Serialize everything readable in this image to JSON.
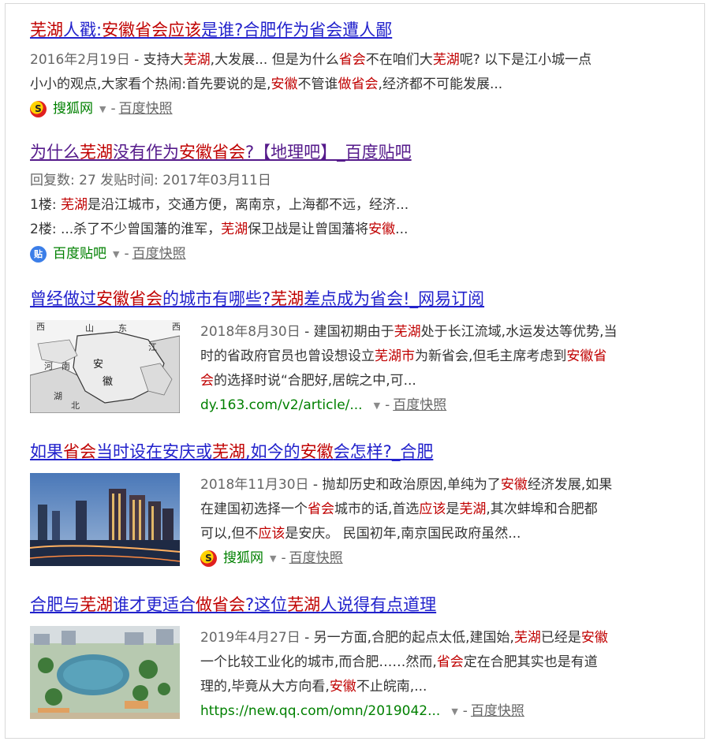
{
  "results": [
    {
      "title_parts": [
        "芜湖",
        "人戳:",
        "安徽省会",
        "应该",
        "是谁?合肥作为省会遭人鄙"
      ],
      "snippet_line1": [
        "2016年2月19日",
        " - 支持大",
        "芜湖",
        ",大发展... 但是为什么",
        "省会",
        "不在咱们大",
        "芜湖",
        "呢? 以下是江小城一点"
      ],
      "snippet_line2": [
        "小小的观点,大家看个热闹:首先要说的是,",
        "安徽",
        "不管谁",
        "做省会",
        ",经济都不可能发展..."
      ],
      "source": "搜狐网",
      "snapshot": "百度快照"
    },
    {
      "title_parts": [
        "为什么",
        "芜湖",
        "没有作为",
        "安徽省会",
        "?【地理吧】_百度贴吧"
      ],
      "meta": "回复数: 27 发贴时间: 2017年03月11日",
      "floor1": [
        "1楼: ",
        "芜湖",
        "是沿江城市，交通方便，离南京，上海都不远，经济..."
      ],
      "floor2": [
        "2楼: ...杀了不少曾国藩的淮军，",
        "芜湖",
        "保卫战是让曾国藩将",
        "安徽",
        "..."
      ],
      "source": "百度贴吧",
      "snapshot": "百度快照"
    },
    {
      "title_parts": [
        "曾经做过",
        "安徽省会",
        "的城市有哪些?",
        "芜湖",
        "差点成为省会!_网易订阅"
      ],
      "line1": [
        "2018年8月30日",
        " - 建国初期由于",
        "芜湖",
        "处于长江流域,水运发达等优势,当"
      ],
      "line2": [
        "时的省政府官员也曾设想设立",
        "芜湖市",
        "为新省会,但毛主席考虑到",
        "安徽省"
      ],
      "line3": [
        "会",
        "的选择时说“合肥好,居皖之中,可..."
      ],
      "url": "dy.163.com/v2/article/...",
      "snapshot": "百度快照",
      "map_labels": [
        "西",
        "山",
        "东",
        "河",
        "南",
        "安",
        "江",
        "徽",
        "湖",
        "北",
        "西"
      ]
    },
    {
      "title_parts": [
        "如果",
        "省会",
        "当时设在安庆或",
        "芜湖",
        ",如今的",
        "安徽",
        "会怎样?_合肥"
      ],
      "line1": [
        "2018年11月30日",
        " - 抛却历史和政治原因,单纯为了",
        "安徽",
        "经济发展,如果"
      ],
      "line2": [
        "在建国初选择一个",
        "省会",
        "城市的话,首选",
        "应该",
        "是",
        "芜湖",
        ",其次蚌埠和合肥都"
      ],
      "line3": [
        "可以,但不",
        "应该",
        "是安庆。 民国初年,南京国民政府虽然..."
      ],
      "source": "搜狐网",
      "snapshot": "百度快照"
    },
    {
      "title_parts": [
        "合肥与",
        "芜湖",
        "谁才更适合",
        "做省会",
        "?这位",
        "芜湖",
        "人说得有点道理"
      ],
      "line1": [
        "2019年4月27日",
        " - 另一方面,合肥的起点太低,建国始,",
        "芜湖",
        "已经是",
        "安徽"
      ],
      "line2": [
        "一个比较工业化的城市,而合肥……然而,",
        "省会",
        "定在合肥其实也是有道"
      ],
      "line3": [
        "理的,毕竟从大方向看,",
        "安徽",
        "不止皖南,..."
      ],
      "url": "https://new.qq.com/omn/2019042...",
      "snapshot": "百度快照"
    }
  ],
  "icons": {
    "sohu": "sohu-logo-icon",
    "tieba": "tieba-logo-icon",
    "dropdown": "dropdown-caret-icon"
  },
  "colors": {
    "title": "#2222cc",
    "visited": "#551a8b",
    "highlight": "#c00000",
    "green": "#008000"
  }
}
